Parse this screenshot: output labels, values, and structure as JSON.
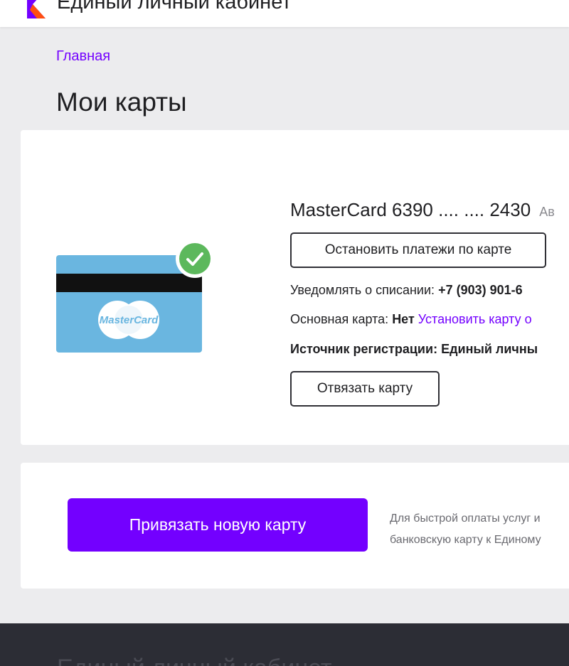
{
  "header": {
    "title": "Единый личный кабинет"
  },
  "breadcrumb": {
    "home": "Главная"
  },
  "page": {
    "title": "Мои карты"
  },
  "card": {
    "brand": "MasterCard",
    "name": "MasterCard 6390 .... .... 2430",
    "status": "Ав",
    "stop_payments_label": "Остановить платежи по карте",
    "notify_label": "Уведомлять о списании:",
    "notify_value": "+7 (903) 901-6",
    "main_label": "Основная карта:",
    "main_value": "Нет",
    "main_link": "Установить карту о",
    "source_label": "Источник регистрации:",
    "source_value": "Единый личны",
    "unbind_label": "Отвязать карту"
  },
  "bind": {
    "button_label": "Привязать новую карту",
    "hint_line1": "Для быстрой оплаты услуг и",
    "hint_line2": "банковскую карту к Единому"
  },
  "footer": {
    "text": "Единый личный кабинет"
  },
  "colors": {
    "accent": "#7300ff",
    "check": "#5cb85c",
    "card": "#6ab6e0",
    "footer": "#2c2d35"
  }
}
